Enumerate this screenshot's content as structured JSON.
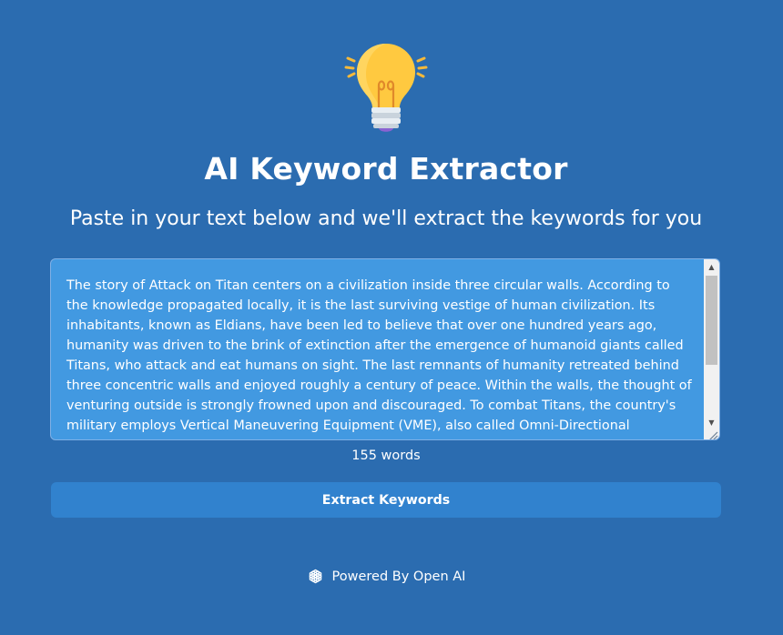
{
  "header": {
    "logo_icon": "lightbulb-icon",
    "title": "AI Keyword Extractor",
    "subtitle": "Paste in your text below and we'll extract the keywords for you"
  },
  "input": {
    "value": "The story of Attack on Titan centers on a civilization inside three circular walls. According to the knowledge propagated locally, it is the last surviving vestige of human civilization. Its inhabitants, known as Eldians, have been led to believe that over one hundred years ago, humanity was driven to the brink of extinction after the emergence of humanoid giants called Titans, who attack and eat humans on sight. The last remnants of humanity retreated behind three concentric walls and enjoyed roughly a century of peace. Within the walls, the thought of venturing outside is strongly frowned upon and discouraged. To combat Titans, the country's military employs Vertical Maneuvering Equipment (VME), also called Omni-Directional Maneuvering Gear (ODM Gear)"
  },
  "word_count": "155 words",
  "actions": {
    "extract_label": "Extract Keywords"
  },
  "footer": {
    "icon": "openai-icon",
    "text": "Powered By Open AI"
  },
  "colors": {
    "background": "#2b6cb0",
    "textarea": "#4299e1",
    "button": "#3182ce",
    "bulb": "#ffc940"
  }
}
